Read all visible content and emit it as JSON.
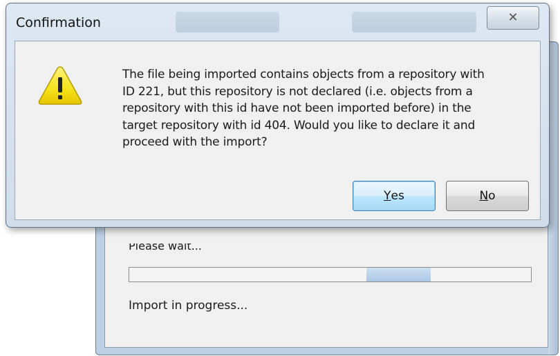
{
  "background_window": {
    "wait_label": "Please wait...",
    "progress": {
      "fill_start_fraction": 0.59,
      "fill_width_fraction": 0.16
    },
    "status_text": "Import in progress..."
  },
  "dialog": {
    "title": "Confirmation",
    "close_icon": "close-icon",
    "icon": "warning-icon",
    "message": "The file being imported contains objects from a repository with\nID 221, but this repository is not declared (i.e. objects from a\nrepository with this id have not been imported before) in the\ntarget repository with id 404. Would you like to declare it and\nproceed with the import?",
    "buttons": {
      "yes": {
        "mnemonic": "Y",
        "rest": "es"
      },
      "no": {
        "mnemonic": "N",
        "rest": "o"
      }
    }
  },
  "colors": {
    "warning_yellow": "#f5e21b",
    "dialog_frame": "#dde8f3",
    "progress_fill": "#a9c6e6"
  }
}
